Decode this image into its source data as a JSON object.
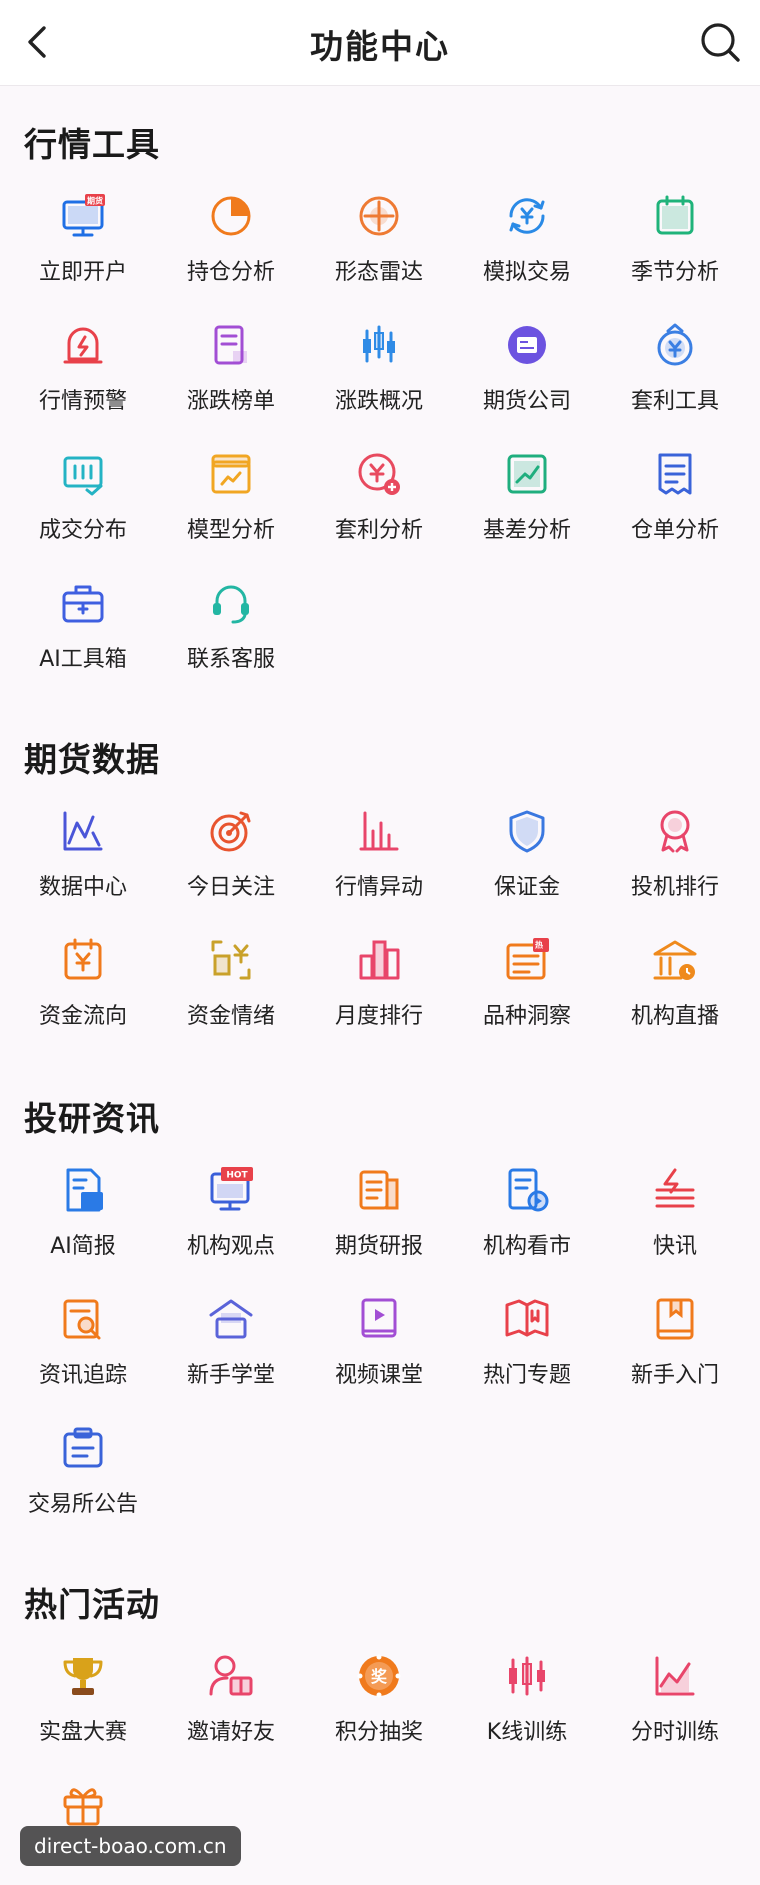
{
  "header": {
    "title": "功能中心"
  },
  "sections": [
    {
      "title": "行情工具",
      "items": [
        {
          "label": "立即开户",
          "icon": "monitor-futures-icon",
          "color": "#1f6fe5",
          "badge": "期货"
        },
        {
          "label": "持仓分析",
          "icon": "pie-chart-icon",
          "color": "#f07a1c"
        },
        {
          "label": "形态雷达",
          "icon": "radar-target-icon",
          "color": "#ee7a33"
        },
        {
          "label": "模拟交易",
          "icon": "yuan-exchange-icon",
          "color": "#2a8ae6"
        },
        {
          "label": "季节分析",
          "icon": "season-calendar-icon",
          "color": "#1fb37a"
        },
        {
          "label": "行情预警",
          "icon": "alarm-bell-icon",
          "color": "#e8414a"
        },
        {
          "label": "涨跌榜单",
          "icon": "list-document-icon",
          "color": "#a24ed4"
        },
        {
          "label": "涨跌概况",
          "icon": "candlestick-icon",
          "color": "#2f8be6"
        },
        {
          "label": "期货公司",
          "icon": "company-card-icon",
          "color": "#6c53e0"
        },
        {
          "label": "套利工具",
          "icon": "money-bag-icon",
          "color": "#3b7fe3"
        },
        {
          "label": "成交分布",
          "icon": "bar-check-icon",
          "color": "#24b3c4"
        },
        {
          "label": "模型分析",
          "icon": "model-box-icon",
          "color": "#f1a623"
        },
        {
          "label": "套利分析",
          "icon": "yuan-plus-icon",
          "color": "#e84a5f"
        },
        {
          "label": "基差分析",
          "icon": "trend-box-icon",
          "color": "#1fae7e"
        },
        {
          "label": "仓单分析",
          "icon": "receipt-icon",
          "color": "#3a63d9"
        },
        {
          "label": "AI工具箱",
          "icon": "toolbox-icon",
          "color": "#3f5fe0"
        },
        {
          "label": "联系客服",
          "icon": "headset-icon",
          "color": "#23b6a3"
        }
      ]
    },
    {
      "title": "期货数据",
      "items": [
        {
          "label": "数据中心",
          "icon": "data-axis-icon",
          "color": "#4a55d8"
        },
        {
          "label": "今日关注",
          "icon": "target-arrow-icon",
          "color": "#e8542f"
        },
        {
          "label": "行情异动",
          "icon": "bar-chart-icon",
          "color": "#e8456a"
        },
        {
          "label": "保证金",
          "icon": "shield-icon",
          "color": "#3a78e0"
        },
        {
          "label": "投机排行",
          "icon": "medal-icon",
          "color": "#e8456a"
        },
        {
          "label": "资金流向",
          "icon": "fund-flow-icon",
          "color": "#f07a1c"
        },
        {
          "label": "资金情绪",
          "icon": "fund-mood-icon",
          "color": "#c9a12a"
        },
        {
          "label": "月度排行",
          "icon": "ranking-bars-icon",
          "color": "#e8456a"
        },
        {
          "label": "品种洞察",
          "icon": "hot-list-icon",
          "color": "#f07a1c",
          "badge": "热"
        },
        {
          "label": "机构直播",
          "icon": "institution-icon",
          "color": "#ef8a1c"
        }
      ]
    },
    {
      "title": "投研资讯",
      "items": [
        {
          "label": "AI简报",
          "icon": "ai-document-icon",
          "color": "#2a7ae6"
        },
        {
          "label": "机构观点",
          "icon": "hot-monitor-icon",
          "color": "#3a5fd9",
          "badge": "HOT"
        },
        {
          "label": "期货研报",
          "icon": "report-icon",
          "color": "#f07a1c"
        },
        {
          "label": "机构看市",
          "icon": "video-document-icon",
          "color": "#2a7ae6"
        },
        {
          "label": "快讯",
          "icon": "flash-news-icon",
          "color": "#e8414a"
        },
        {
          "label": "资讯追踪",
          "icon": "search-document-icon",
          "color": "#f07a1c"
        },
        {
          "label": "新手学堂",
          "icon": "school-icon",
          "color": "#5a63d9"
        },
        {
          "label": "视频课堂",
          "icon": "video-book-icon",
          "color": "#a24ed4"
        },
        {
          "label": "热门专题",
          "icon": "open-book-icon",
          "color": "#e8414a"
        },
        {
          "label": "新手入门",
          "icon": "bookmark-book-icon",
          "color": "#f07a1c"
        },
        {
          "label": "交易所公告",
          "icon": "clipboard-icon",
          "color": "#3a63d9"
        }
      ]
    },
    {
      "title": "热门活动",
      "items": [
        {
          "label": "实盘大赛",
          "icon": "trophy-icon",
          "color": "#d9a21a"
        },
        {
          "label": "邀请好友",
          "icon": "invite-friend-icon",
          "color": "#e8456a"
        },
        {
          "label": "积分抽奖",
          "icon": "lottery-wheel-icon",
          "color": "#f07a1c",
          "badge": "奖"
        },
        {
          "label": "K线训练",
          "icon": "kline-icon",
          "color": "#e8456a"
        },
        {
          "label": "分时训练",
          "icon": "line-chart-icon",
          "color": "#e8456a"
        },
        {
          "label": "",
          "icon": "gift-icon",
          "color": "#f07a1c"
        }
      ]
    }
  ],
  "watermark": "direct-boao.com.cn"
}
